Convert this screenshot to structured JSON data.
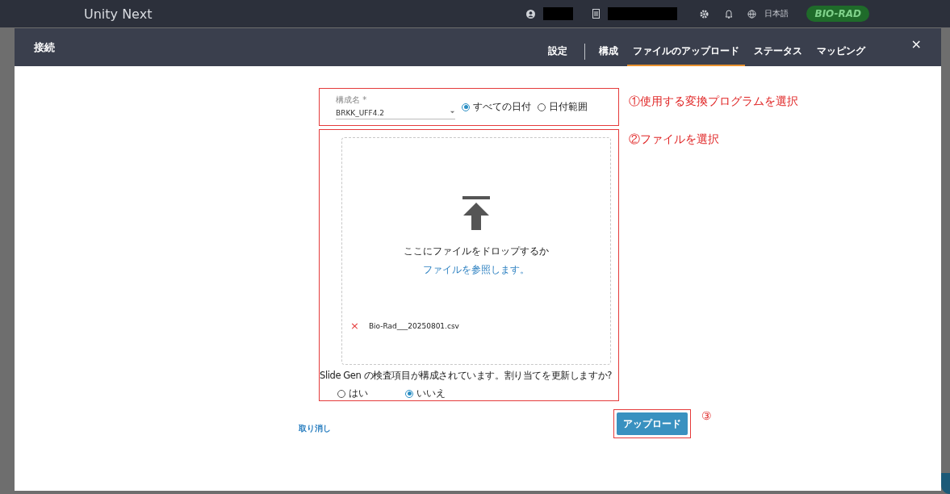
{
  "top_bar": {
    "app_title": "Unity Next",
    "language": "日本語",
    "logo": "BIO-RAD"
  },
  "dialog": {
    "title": "接続",
    "close": "×",
    "tabs": [
      {
        "label": "設定",
        "selected": false
      },
      {
        "label": "構成",
        "selected": false
      },
      {
        "label": "ファイルのアップロード",
        "selected": true
      },
      {
        "label": "ステータス",
        "selected": false
      },
      {
        "label": "マッピング",
        "selected": false
      }
    ]
  },
  "config_field": {
    "label": "構成名 *",
    "value": "BRKK_UFF4.2"
  },
  "date_options": [
    {
      "label": "すべての日付",
      "selected": true
    },
    {
      "label": "日付範囲",
      "selected": false
    }
  ],
  "dropzone": {
    "prompt": "ここにファイルをドロップするか",
    "link": "ファイルを参照します。"
  },
  "files": [
    {
      "name": "Bio-Rad___20250801.csv",
      "remove": "×"
    }
  ],
  "question": "Slide Gen の検査項目が構成されています。割り当てを更新しますか?",
  "answer_options": [
    {
      "label": "はい",
      "selected": false
    },
    {
      "label": "いいえ",
      "selected": true
    }
  ],
  "cancel": "取り消し",
  "upload": "アップロード",
  "annotations": [
    "①使用する変換プログラムを選択",
    "②ファイルを選択",
    "③"
  ]
}
